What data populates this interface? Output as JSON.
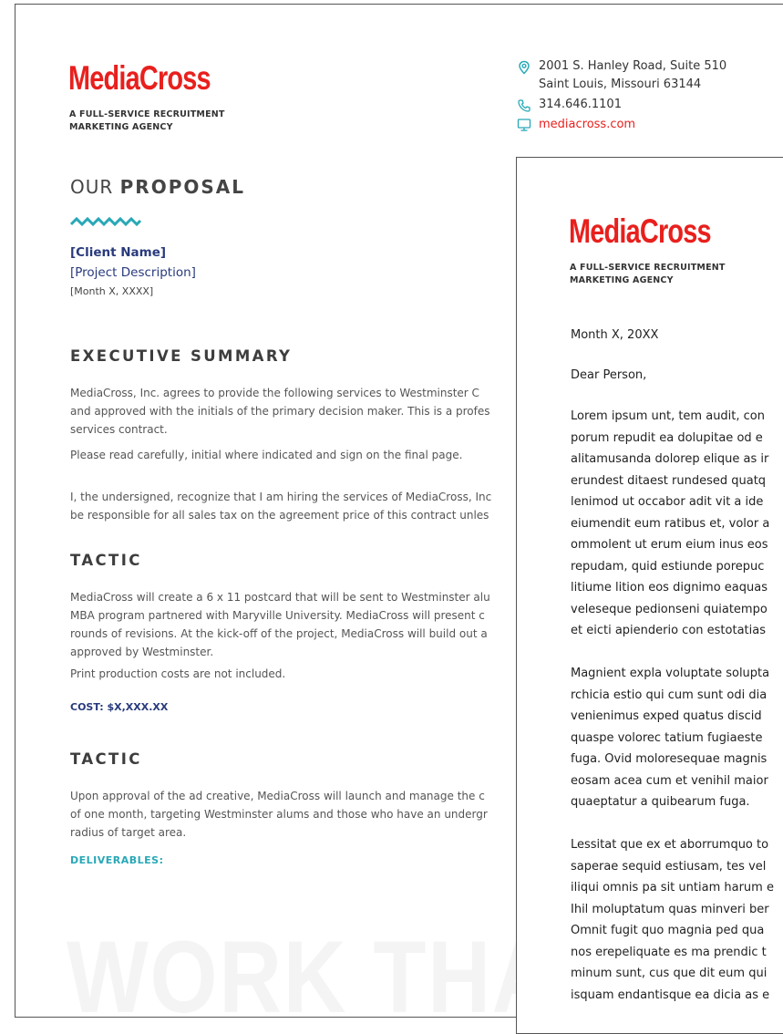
{
  "logo": {
    "text": "MediaCross",
    "tagline_line1": "A FULL-SERVICE RECRUITMENT",
    "tagline_line2": "MARKETING AGENCY"
  },
  "contact": {
    "address_line1": "2001 S. Hanley Road, Suite 510",
    "address_line2": "Saint Louis, Missouri 63144",
    "phone": "314.646.1101",
    "website": "mediacross.com"
  },
  "proposal": {
    "heading_light": "OUR ",
    "heading_bold": "PROPOSAL",
    "client_name": "[Client Name]",
    "project_description": "[Project Description]",
    "date": "[Month X, XXXX]"
  },
  "executive_summary": {
    "title": "EXECUTIVE SUMMARY",
    "p1": [
      "MediaCross, Inc. agrees to provide the following services to Westminster C",
      "and approved with the initials of the primary decision maker. This is a profes",
      "services contract."
    ],
    "p2": "Please read carefully, initial where indicated and sign on the final page.",
    "p3": [
      "I, the undersigned, recognize that I am hiring the services of MediaCross, Inc",
      "be responsible for all sales tax on the agreement price of this contract unles"
    ]
  },
  "tactic1": {
    "title": "TACTIC",
    "p1": [
      "MediaCross will create a 6 x 11 postcard that will be sent to Westminster alu",
      "MBA program partnered with Maryville University. MediaCross will present c",
      "rounds of revisions. At the kick-off of the project, MediaCross will build out a",
      "approved by Westminster."
    ],
    "p2": "Print production costs are not included.",
    "cost_label": "COST: ",
    "cost_value": "$X,XXX.XX"
  },
  "tactic2": {
    "title": "TACTIC",
    "p1": [
      "Upon approval of the ad creative, MediaCross will launch and manage the c",
      "of one month, targeting Westminster alums and those who have an undergr",
      "radius of target area."
    ],
    "deliverables": "DELIVERABLES:"
  },
  "watermark": "WORK THAT M",
  "letter": {
    "date": "Month X, 20XX",
    "salutation": "Dear Person,",
    "p1": [
      "Lorem ipsum unt, tem audit, con",
      "porum repudit ea dolupitae od e",
      "alitamusanda dolorep elique as ir",
      "erundest ditaest rundesed quatq",
      "lenimod ut occabor adit vit a ide",
      "eiumendit eum ratibus et, volor a",
      "ommolent ut erum eium inus eos",
      "repudam, quid estiunde porepuc",
      "litiume lition eos dignimo eaquas",
      "veleseque pedionseni quiatempo",
      "et eicti apienderio con estotatias"
    ],
    "p2": [
      "Magnient expla voluptate solupta",
      "rchicia estio qui cum sunt odi dia",
      "venienimus exped quatus discid",
      "quaspe volorec tatium fugiaeste",
      "fuga. Ovid moloresequae magnis",
      "eosam acea cum et venihil maior",
      "quaeptatur a quibearum fuga."
    ],
    "p3": [
      "Lessitat que ex et aborrumquo to",
      "saperae sequid estiusam, tes vel",
      "iliqui omnis pa sit untiam harum e",
      "Ihil moluptatum quas minveri ber",
      "Omnit fugit quo magnia ped qua",
      "nos erepeliquate es ma prendic t",
      "minum sunt, cus que dit eum qui",
      "isquam endantisque ea dicia as e"
    ]
  },
  "colors": {
    "brand_red": "#e8201d",
    "navy": "#283a7c",
    "teal": "#28a8b7"
  }
}
